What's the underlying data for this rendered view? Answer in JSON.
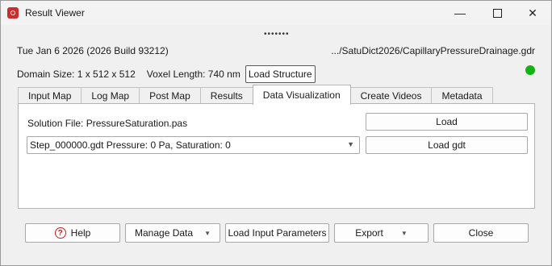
{
  "window": {
    "title": "Result Viewer"
  },
  "header": {
    "date_build": "Tue Jan 6 2026 (2026 Build 93212)",
    "file_path": ".../SatuDict2026/CapillaryPressureDrainage.gdr",
    "domain_size": "Domain Size: 1 x 512 x 512",
    "voxel_length": "Voxel Length: 740 nm",
    "load_structure_label": "Load Structure",
    "status_color": "#12b312"
  },
  "tabs": [
    {
      "label": "Input Map"
    },
    {
      "label": "Log Map"
    },
    {
      "label": "Post Map"
    },
    {
      "label": "Results"
    },
    {
      "label": "Data Visualization",
      "active": true
    },
    {
      "label": "Create Videos"
    },
    {
      "label": "Metadata"
    }
  ],
  "panel": {
    "solution_file": "Solution File: PressureSaturation.pas",
    "load_label": "Load",
    "step_select_value": "Step_000000.gdt Pressure: 0 Pa, Saturation: 0",
    "load_gdt_label": "Load gdt"
  },
  "footer": {
    "help": "Help",
    "manage_data": "Manage Data",
    "load_input_params": "Load Input Parameters",
    "export": "Export",
    "close": "Close"
  }
}
